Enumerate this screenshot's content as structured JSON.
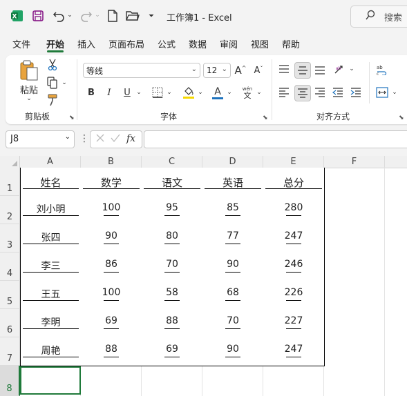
{
  "titlebar": {
    "title": "工作簿1  -  Excel",
    "search_label": "搜索",
    "icons": [
      "excel-logo-icon",
      "save-icon",
      "undo-icon",
      "redo-icon",
      "new-file-icon",
      "open-folder-icon",
      "customize-qat-icon",
      "search-icon"
    ]
  },
  "tabs": [
    "文件",
    "开始",
    "插入",
    "页面布局",
    "公式",
    "数据",
    "审阅",
    "视图",
    "帮助"
  ],
  "active_tab": "开始",
  "ribbon": {
    "clipboard": {
      "paste_label": "粘贴",
      "group_label": "剪贴板"
    },
    "font": {
      "font_name": "等线",
      "font_size": "12",
      "group_label": "字体",
      "bold": "B",
      "italic": "I",
      "underline": "U",
      "font_color_letter": "A",
      "phonetic_top": "wén",
      "phonetic_bottom": "文",
      "grow": "A",
      "shrink": "A"
    },
    "alignment": {
      "group_label": "对齐方式"
    }
  },
  "formula_bar": {
    "name_box": "J8",
    "fx_label": "fx",
    "formula": ""
  },
  "colors": {
    "accent": "#1f7a3a",
    "font_highlight": "#f5d800",
    "font_color": "#1e73be"
  },
  "sheet": {
    "columns": [
      "A",
      "B",
      "C",
      "D",
      "E",
      "F"
    ],
    "rows": [
      "1",
      "2",
      "3",
      "4",
      "5",
      "6",
      "7",
      "8"
    ],
    "table": [
      [
        "姓名",
        "数学",
        "语文",
        "英语",
        "总分"
      ],
      [
        "刘小明",
        "100",
        "95",
        "85",
        "280"
      ],
      [
        "张四",
        "90",
        "80",
        "77",
        "247"
      ],
      [
        "李三",
        "86",
        "70",
        "90",
        "246"
      ],
      [
        "王五",
        "100",
        "58",
        "68",
        "226"
      ],
      [
        "李明",
        "69",
        "88",
        "70",
        "227"
      ],
      [
        "周艳",
        "88",
        "69",
        "90",
        "247"
      ]
    ]
  }
}
